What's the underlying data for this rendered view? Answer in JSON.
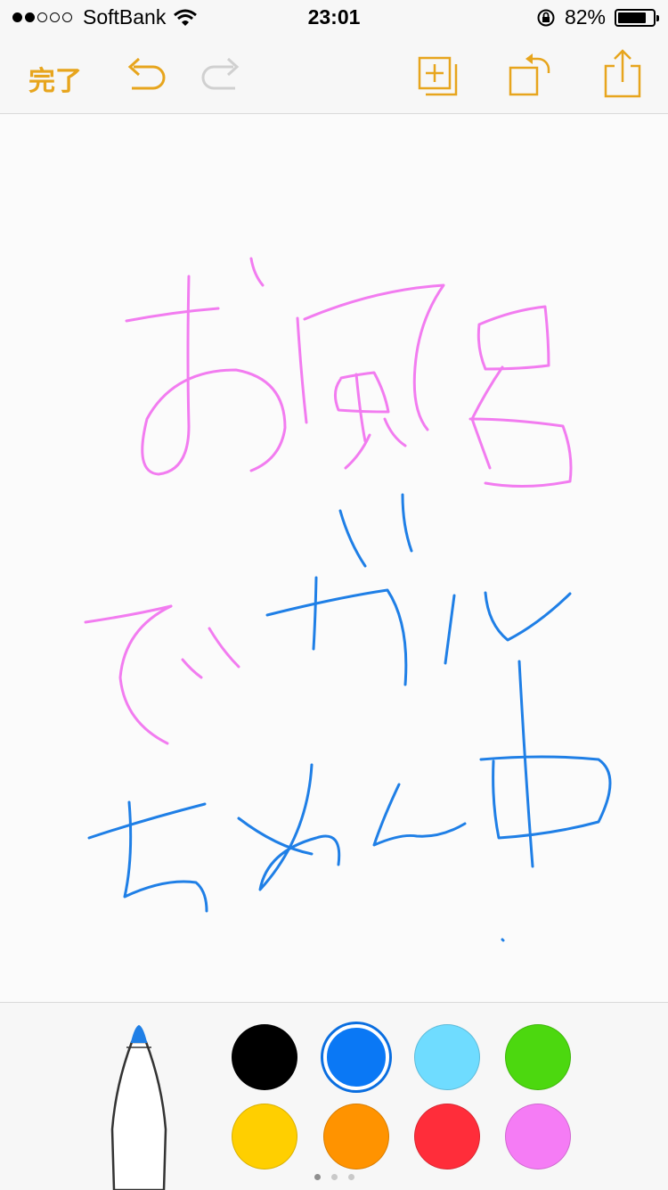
{
  "status": {
    "carrier": "SoftBank",
    "time": "23:01",
    "battery": "82%",
    "battery_level": 0.82,
    "signal_bars_filled": 2,
    "signal_bars_total": 5
  },
  "toolbar": {
    "done_label": "完了"
  },
  "colors": {
    "accent": "#e7a51d",
    "pink_ink": "#f27cf0",
    "blue_ink": "#1f7fe6"
  },
  "palette": {
    "selected": 1,
    "swatches": [
      "#000000",
      "#0a78f5",
      "#6fdcff",
      "#4cd80f",
      "#ffcf00",
      "#ff9300",
      "#ff2d3a",
      "#f57cf5"
    ]
  },
  "pages": {
    "count": 3,
    "current": 0
  }
}
